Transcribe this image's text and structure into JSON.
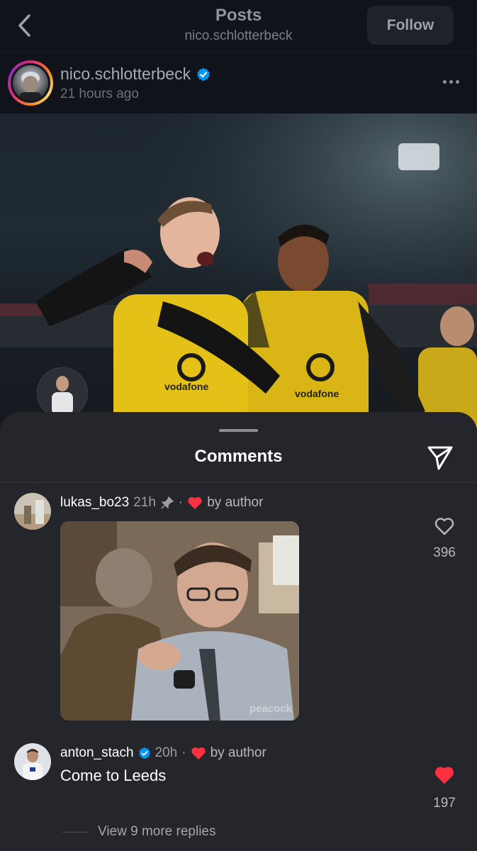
{
  "nav": {
    "title": "Posts",
    "subtitle": "nico.schlotterbeck",
    "follow_label": "Follow"
  },
  "post": {
    "author": "nico.schlotterbeck",
    "time": "21 hours ago",
    "photo_logos": [
      "vodafone",
      "vodafone"
    ]
  },
  "comments_sheet": {
    "title": "Comments",
    "comments": [
      {
        "user": "lukas_bo23",
        "time": "21h",
        "pinned": true,
        "liked_by": "by author",
        "gif_watermark": "peacock",
        "likes": "396",
        "liked": false
      },
      {
        "user": "anton_stach",
        "verified": true,
        "time": "20h",
        "dot": "·",
        "liked_by": "by author",
        "text": "Come to Leeds",
        "likes": "197",
        "liked": true
      }
    ],
    "view_more": "View 9 more replies"
  },
  "colors": {
    "like_red": "#ff3040",
    "verified_blue": "#0095f6",
    "sheet_bg": "#24262b",
    "jersey_yellow": "#e9c515"
  }
}
